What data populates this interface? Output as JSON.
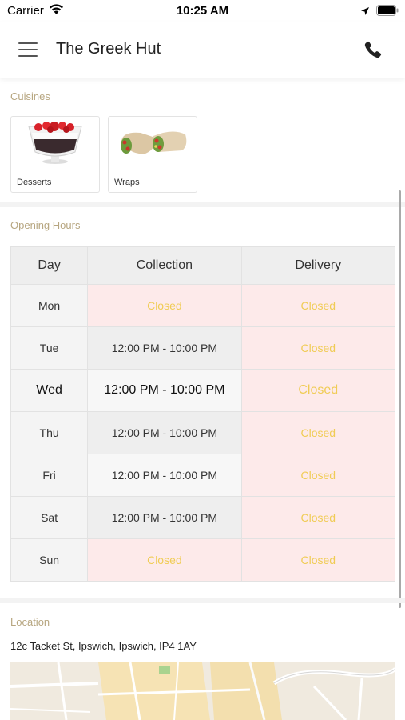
{
  "status_bar": {
    "carrier": "Carrier",
    "time": "10:25 AM"
  },
  "header": {
    "title": "The Greek Hut"
  },
  "cuisines": {
    "heading": "Cuisines",
    "items": [
      {
        "label": "Desserts"
      },
      {
        "label": "Wraps"
      }
    ]
  },
  "opening_hours": {
    "heading": "Opening Hours",
    "columns": [
      "Day",
      "Collection",
      "Delivery"
    ],
    "rows": [
      {
        "day": "Mon",
        "collection": "Closed",
        "delivery": "Closed"
      },
      {
        "day": "Tue",
        "collection": "12:00 PM - 10:00 PM",
        "delivery": "Closed"
      },
      {
        "day": "Wed",
        "collection": "12:00 PM - 10:00 PM",
        "delivery": "Closed"
      },
      {
        "day": "Thu",
        "collection": "12:00 PM - 10:00 PM",
        "delivery": "Closed"
      },
      {
        "day": "Fri",
        "collection": "12:00 PM - 10:00 PM",
        "delivery": "Closed"
      },
      {
        "day": "Sat",
        "collection": "12:00 PM - 10:00 PM",
        "delivery": "Closed"
      },
      {
        "day": "Sun",
        "collection": "Closed",
        "delivery": "Closed"
      }
    ],
    "highlighted_day": "Wed"
  },
  "location": {
    "heading": "Location",
    "address": "12c Tacket St, Ipswich, Ipswich, IP4 1AY"
  },
  "colors": {
    "section_label": "#b7a680",
    "closed_text": "#f0cc55",
    "closed_bg": "#fdeaea"
  }
}
